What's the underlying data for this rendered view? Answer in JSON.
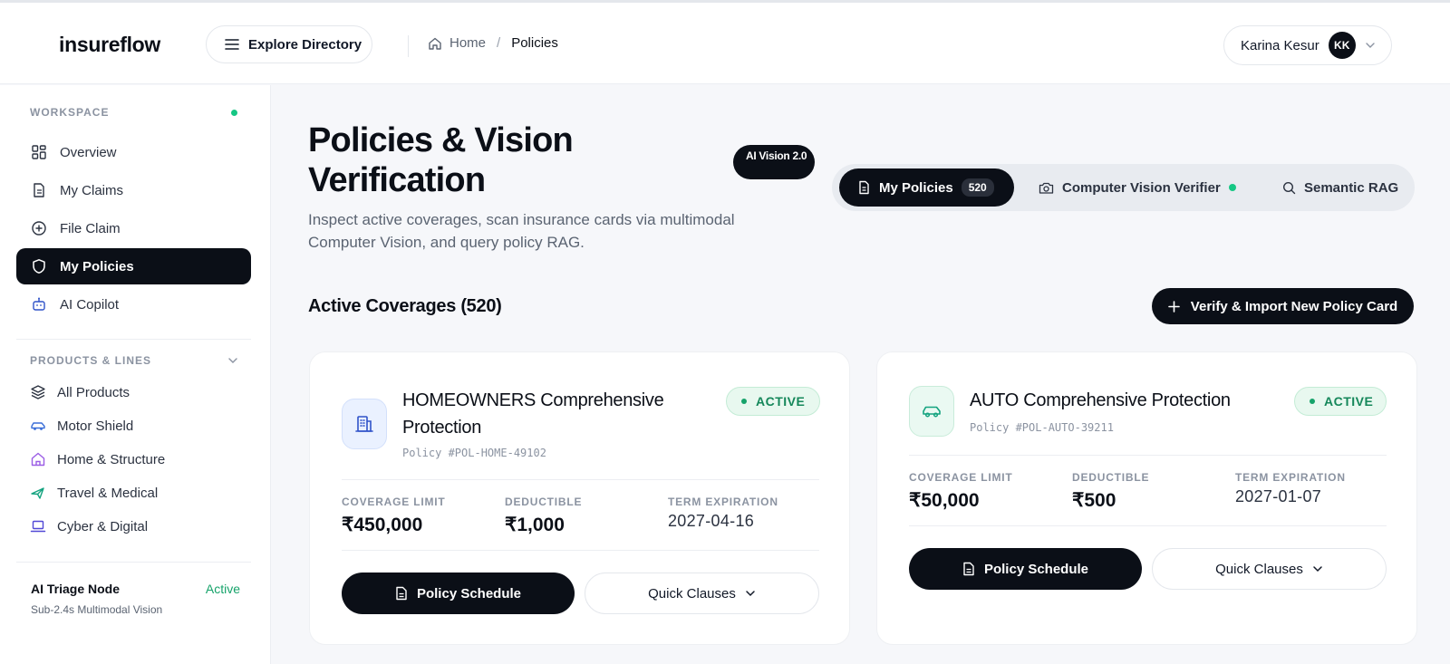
{
  "app": {
    "logo": "insureflow"
  },
  "header": {
    "explore_label": "Explore Directory",
    "breadcrumb": {
      "home": "Home",
      "separator": "/",
      "current": "Policies"
    },
    "user": {
      "name": "Karina Kesur",
      "initials": "KK"
    }
  },
  "sidebar": {
    "workspace_label": "WORKSPACE",
    "items": [
      {
        "label": "Overview",
        "icon": "grid-icon"
      },
      {
        "label": "My Claims",
        "icon": "document-icon"
      },
      {
        "label": "File Claim",
        "icon": "plus-circle-icon"
      },
      {
        "label": "My Policies",
        "icon": "shield-icon",
        "active": true
      },
      {
        "label": "AI Copilot",
        "icon": "bot-icon"
      }
    ],
    "products_label": "PRODUCTS & LINES",
    "products": [
      {
        "label": "All Products",
        "icon": "layers-icon"
      },
      {
        "label": "Motor Shield",
        "icon": "car-icon"
      },
      {
        "label": "Home & Structure",
        "icon": "house-icon"
      },
      {
        "label": "Travel & Medical",
        "icon": "plane-icon"
      },
      {
        "label": "Cyber & Digital",
        "icon": "laptop-icon"
      }
    ],
    "triage": {
      "title": "AI Triage Node",
      "status": "Active",
      "subtitle": "Sub-2.4s Multimodal Vision"
    }
  },
  "main": {
    "title": "Policies & Vision Verification",
    "badge": "AI Vision 2.0",
    "subtitle": "Inspect active coverages, scan insurance cards via multimodal Computer Vision, and query policy RAG.",
    "tabs": [
      {
        "label": "My Policies",
        "count": "520",
        "active": true
      },
      {
        "label": "Computer Vision Verifier"
      },
      {
        "label": "Semantic RAG"
      }
    ],
    "section_title": "Active Coverages (520)",
    "verify_button": "Verify & Import New Policy Card",
    "cards": [
      {
        "title": "HOMEOWNERS Comprehensive Protection",
        "policy": "Policy #POL-HOME-49102",
        "status": "ACTIVE",
        "coverage_label": "COVERAGE LIMIT",
        "coverage": "₹450,000",
        "deductible_label": "DEDUCTIBLE",
        "deductible": "₹1,000",
        "expiration_label": "TERM EXPIRATION",
        "expiration": "2027-04-16",
        "schedule_button": "Policy Schedule",
        "clauses_button": "Quick Clauses"
      },
      {
        "title": "AUTO Comprehensive Protection",
        "policy": "Policy #POL-AUTO-39211",
        "status": "ACTIVE",
        "coverage_label": "COVERAGE LIMIT",
        "coverage": "₹50,000",
        "deductible_label": "DEDUCTIBLE",
        "deductible": "₹500",
        "expiration_label": "TERM EXPIRATION",
        "expiration": "2027-01-07",
        "schedule_button": "Policy Schedule",
        "clauses_button": "Quick Clauses"
      }
    ]
  },
  "colors": {
    "primary": "#0b0f17",
    "success": "#16a36a",
    "muted": "#8b93a1",
    "background": "#f6f7fa"
  }
}
